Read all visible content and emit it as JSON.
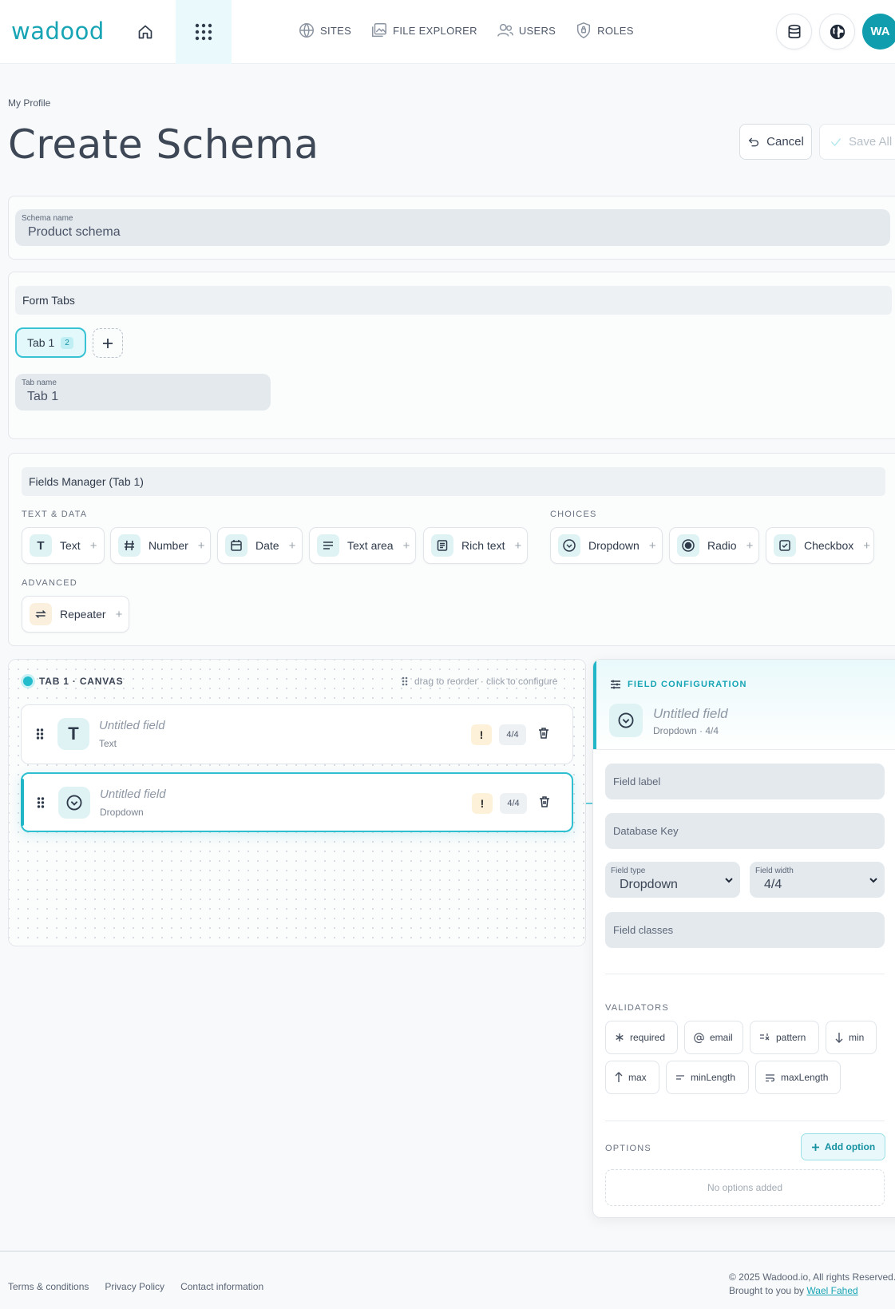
{
  "header": {
    "logo": "wadood",
    "nav": [
      {
        "label": "SITES",
        "icon": "globe-icon"
      },
      {
        "label": "FILE EXPLORER",
        "icon": "images-icon"
      },
      {
        "label": "USERS",
        "icon": "users-icon"
      },
      {
        "label": "ROLES",
        "icon": "shield-icon"
      }
    ],
    "avatar": "WA"
  },
  "page": {
    "breadcrumb": "My Profile",
    "title": "Create Schema",
    "cancel_label": "Cancel",
    "save_label": "Save All"
  },
  "schema": {
    "name_label": "Schema name",
    "name_value": "Product schema"
  },
  "form_tabs": {
    "title": "Form Tabs",
    "tabs": [
      {
        "label": "Tab 1",
        "count": "2"
      }
    ],
    "tab_name_label": "Tab name",
    "tab_name_value": "Tab 1"
  },
  "fields_manager": {
    "title": "Fields Manager (Tab 1)",
    "groups": {
      "text_data": "TEXT & DATA",
      "choices": "CHOICES",
      "advanced": "ADVANCED"
    },
    "chips": {
      "text": "Text",
      "number": "Number",
      "date": "Date",
      "textarea": "Text area",
      "richtext": "Rich text",
      "dropdown": "Dropdown",
      "radio": "Radio",
      "checkbox": "Checkbox",
      "repeater": "Repeater"
    },
    "chip_plus": "+"
  },
  "canvas": {
    "title": "TAB 1 · CANVAS",
    "hint": "drag to reorder · click to configure",
    "fields": [
      {
        "name": "Untitled field",
        "type": "Text",
        "icon_glyph": "T",
        "width": "4/4",
        "warning": "!"
      },
      {
        "name": "Untitled field",
        "type": "Dropdown",
        "width": "4/4",
        "warning": "!"
      }
    ]
  },
  "config": {
    "title": "FIELD CONFIGURATION",
    "field_name": "Untitled field",
    "field_sub": "Dropdown · 4/4",
    "field_label_placeholder": "Field label",
    "db_key_placeholder": "Database Key",
    "field_type_label": "Field type",
    "field_type_value": "Dropdown",
    "field_width_label": "Field width",
    "field_width_value": "4/4",
    "classes_placeholder": "Field classes",
    "validators_title": "VALIDATORS",
    "validators": {
      "required": "required",
      "email": "email",
      "pattern": "pattern",
      "min": "min",
      "max": "max",
      "minLength": "minLength",
      "maxLength": "maxLength"
    },
    "options_title": "OPTIONS",
    "add_option": "Add option",
    "no_options": "No options added"
  },
  "footer": {
    "links": [
      "Terms & conditions",
      "Privacy Policy",
      "Contact information"
    ],
    "copyright": "© 2025 Wadood.io, All rights Reserved.",
    "brought_by": "Brought to you by",
    "author": "Wael Fahed"
  },
  "colors": {
    "brand": "#17a4b4",
    "accent_light": "#dff3f5",
    "warning_bg": "#fdf1d9"
  }
}
